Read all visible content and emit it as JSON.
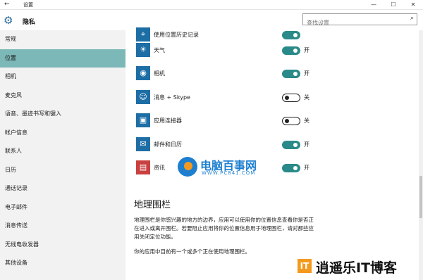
{
  "window": {
    "title": "设置",
    "back_icon": "←",
    "minimize": "—",
    "maximize": "☐",
    "close": "✕"
  },
  "header": {
    "title": "隐私",
    "gear_icon": "⚙"
  },
  "search": {
    "placeholder": "查找设置",
    "icon": "⌕"
  },
  "sidebar": {
    "items": [
      {
        "label": "常规"
      },
      {
        "label": "位置"
      },
      {
        "label": "相机"
      },
      {
        "label": "麦克风"
      },
      {
        "label": "语音、墨迹书写和键入"
      },
      {
        "label": "帐户信息"
      },
      {
        "label": "联系人"
      },
      {
        "label": "日历"
      },
      {
        "label": "通话记录"
      },
      {
        "label": "电子邮件"
      },
      {
        "label": "消息传送"
      },
      {
        "label": "无线电收发器"
      },
      {
        "label": "其他设备"
      }
    ],
    "active_index": 1
  },
  "apps": [
    {
      "label": "使用位置历史记录",
      "state": "",
      "on": true
    },
    {
      "label": "天气",
      "state": "开",
      "on": true
    },
    {
      "label": "相机",
      "state": "开",
      "on": true
    },
    {
      "label": "消息 + Skype",
      "state": "关",
      "on": false
    },
    {
      "label": "应用连接器",
      "state": "关",
      "on": false
    },
    {
      "label": "邮件和日历",
      "state": "开",
      "on": true
    },
    {
      "label": "资讯",
      "state": "开",
      "on": true
    }
  ],
  "geofence": {
    "title": "地理围栏",
    "body": "地理围栏是你感兴趣的地方的边界，应用可以使用你的位置信息查看你是否正在进入或离开围栏。若要阻止应用将你的位置信息用于地理围栏，请对那些应用关闭定位功能。",
    "note": "你的应用中目前有一个或多个正在使用地理围栏。"
  },
  "watermarks": {
    "site1_name": "电脑百事网",
    "site1_url": "WWW.PC841.COM",
    "site2_name": "逍遥乐IT博客",
    "site2_mark": "IT"
  },
  "colors": {
    "accent": "#2a8a8a",
    "nav_active": "#7db8b8",
    "app_icon": "#1e6ea6"
  }
}
